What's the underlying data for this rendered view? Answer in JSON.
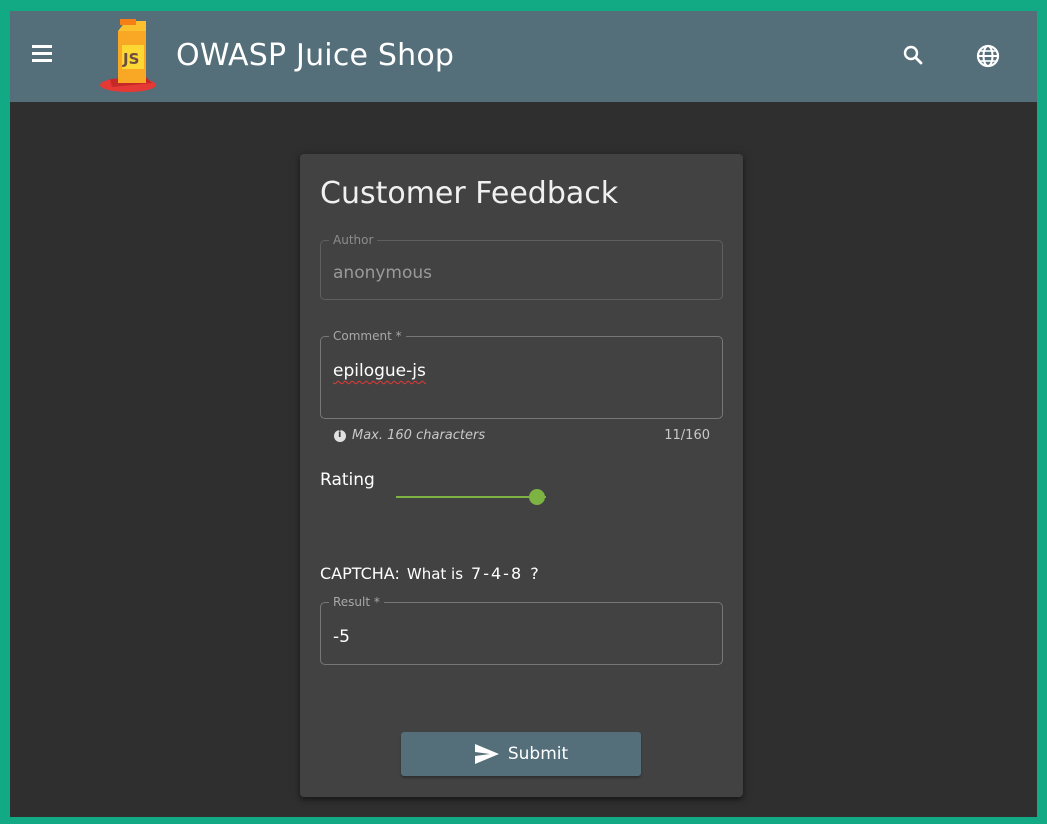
{
  "app": {
    "title": "OWASP Juice Shop",
    "logo_text": "JS"
  },
  "toolbar": {
    "menu_icon": "menu-icon",
    "search_icon": "search-icon",
    "language_icon": "globe-icon",
    "bg_color": "#546e7a"
  },
  "feedback": {
    "title": "Customer Feedback",
    "author": {
      "label": "Author",
      "value": "anonymous"
    },
    "comment": {
      "label": "Comment *",
      "value": "epilogue-js",
      "hint": "Max. 160 characters",
      "counter": "11/160"
    },
    "rating": {
      "label": "Rating",
      "value_fraction": 0.94
    },
    "captcha": {
      "label": "CAPTCHA:",
      "question": "What is",
      "expression": "7-4-8 ?"
    },
    "result": {
      "label": "Result *",
      "value": "-5"
    },
    "submit_label": "Submit"
  },
  "colors": {
    "frame": "#12a985",
    "background": "#2f2f2f",
    "card": "#424242",
    "accent": "#7cb342"
  }
}
